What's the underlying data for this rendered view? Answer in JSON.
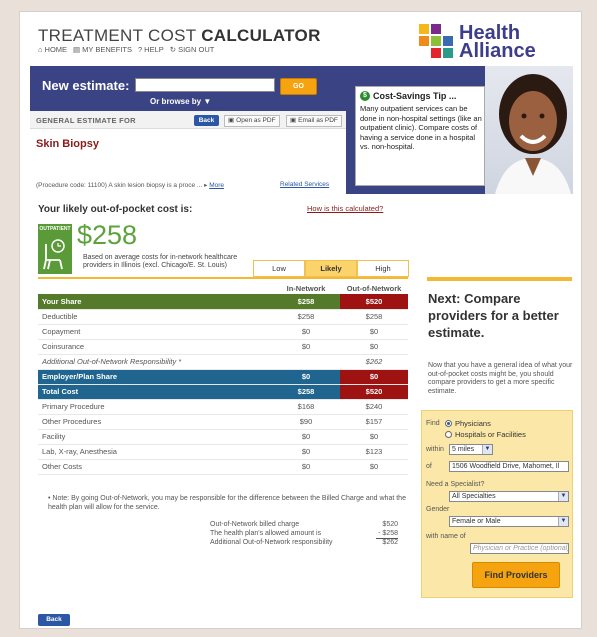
{
  "header": {
    "title_light": "TREATMENT COST ",
    "title_bold": "CALCULATOR",
    "nav": [
      "HOME",
      "MY BENEFITS",
      "HELP",
      "SIGN OUT"
    ],
    "logo_line1": "Health",
    "logo_line2": "Alliance"
  },
  "search": {
    "label": "New estimate:",
    "value": "",
    "go_label": "GO",
    "browse_label": "Or browse by ▼"
  },
  "estimate": {
    "for_label": "GENERAL ESTIMATE FOR",
    "back_label": "Back",
    "pdf_label": "Open as PDF",
    "email_label": "Email as PDF",
    "procedure_name": "Skin Biopsy",
    "procedure_desc": "(Procedure code: 11100) A skin lesion biopsy is a proce ...",
    "more_label": "More",
    "related_label": "Related Services"
  },
  "tip": {
    "title": "Cost-Savings Tip ...",
    "text": "Many outpatient services can be done in non-hospital settings (like an outpatient clinic). Compare costs of having a service done in a hospital vs. non-hospital."
  },
  "cost": {
    "title": "Your likely out-of-pocket cost is:",
    "how_label": "How is this calculated?",
    "badge_label": "OUTPATIENT",
    "amount": "$258",
    "basis": "Based on average costs for in-network healthcare providers in Illinois (excl. Chicago/E. St. Louis)",
    "tabs": [
      "Low",
      "Likely",
      "High"
    ],
    "active_tab": "Likely"
  },
  "table": {
    "col_in": "In-Network",
    "col_out": "Out-of-Network",
    "rows": [
      {
        "label": "Your Share",
        "in": "$258",
        "out": "$520"
      },
      {
        "label": "Deductible",
        "in": "$258",
        "out": "$258"
      },
      {
        "label": "Copayment",
        "in": "$0",
        "out": "$0"
      },
      {
        "label": "Coinsurance",
        "in": "$0",
        "out": "$0"
      },
      {
        "label": "Additional Out-of-Network Responsibility *",
        "in": "",
        "out": "$262"
      },
      {
        "label": "Employer/Plan Share",
        "in": "$0",
        "out": "$0"
      },
      {
        "label": "Total Cost",
        "in": "$258",
        "out": "$520"
      },
      {
        "label": "Primary Procedure",
        "in": "$168",
        "out": "$240"
      },
      {
        "label": "Other Procedures",
        "in": "$90",
        "out": "$157"
      },
      {
        "label": "Facility",
        "in": "$0",
        "out": "$0"
      },
      {
        "label": "Lab, X-ray, Anesthesia",
        "in": "$0",
        "out": "$123"
      },
      {
        "label": "Other Costs",
        "in": "$0",
        "out": "$0"
      }
    ]
  },
  "note": "• Note: By going Out-of-Network, you may be responsible for the difference between the Billed Charge and what the health plan will allow for the service.",
  "calc": {
    "l1": "Out-of-Network billed charge",
    "v1": "$520",
    "l2": "The health plan's allowed amount is",
    "v2": "- $258",
    "l3": "Additional Out-of-Network responsibility",
    "v3": "$262"
  },
  "next": {
    "title": "Next: Compare providers for a better estimate.",
    "desc": "Now that you have a general idea of what your out-of-pocket costs might be, you should compare providers to get a more specific estimate."
  },
  "finder": {
    "find_label": "Find",
    "opt1": "Physicians",
    "opt2": "Hospitals or Facilities",
    "within_label": "within",
    "within_value": "5 miles",
    "of_label": "of",
    "address": "1506 Woodfield Drive, Mahomet, Il",
    "specialist_label": "Need a Specialist?",
    "specialist_value": "All Specialties",
    "gender_label": "Gender",
    "gender_value": "Female or Male",
    "name_label": "with name of",
    "name_placeholder": "Physician or Practice (optional)",
    "button": "Find Providers"
  },
  "footer": {
    "back_label": "Back"
  }
}
